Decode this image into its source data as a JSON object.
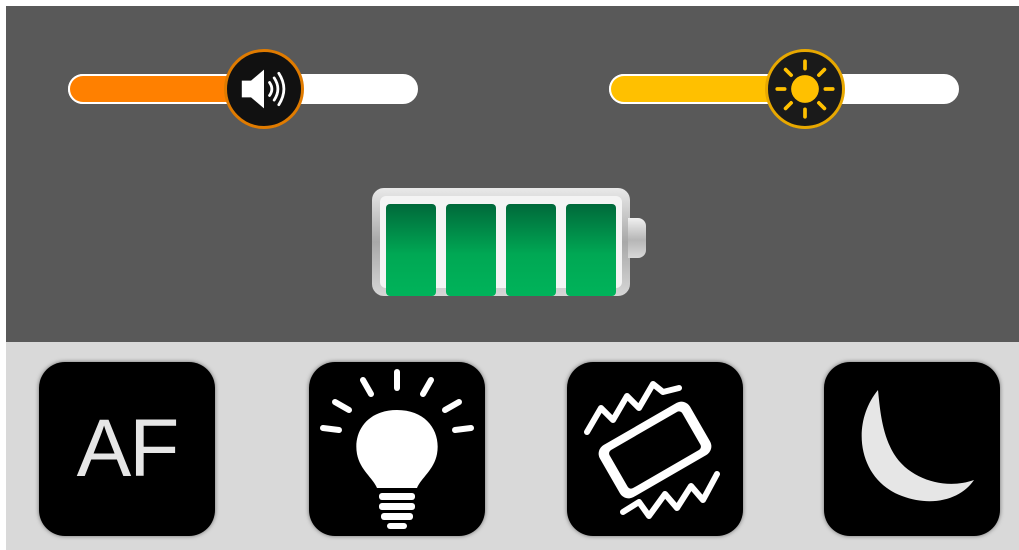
{
  "sliders": {
    "volume": {
      "level": 0.56,
      "fill_color": "#ff8000",
      "accent_color": "#e07b00",
      "icon": "speaker-icon"
    },
    "brightness": {
      "level": 0.56,
      "fill_color": "#ffc000",
      "accent_color": "#e8a800",
      "icon": "sun-icon"
    }
  },
  "battery": {
    "charged_cells": 4,
    "total_cells": 4,
    "cell_color": "#00a854"
  },
  "buttons": [
    {
      "label": "AF",
      "icon": "af-text"
    },
    {
      "label": "",
      "icon": "lightbulb-icon"
    },
    {
      "label": "",
      "icon": "vibrate-phone-icon"
    },
    {
      "label": "",
      "icon": "moon-icon"
    }
  ]
}
